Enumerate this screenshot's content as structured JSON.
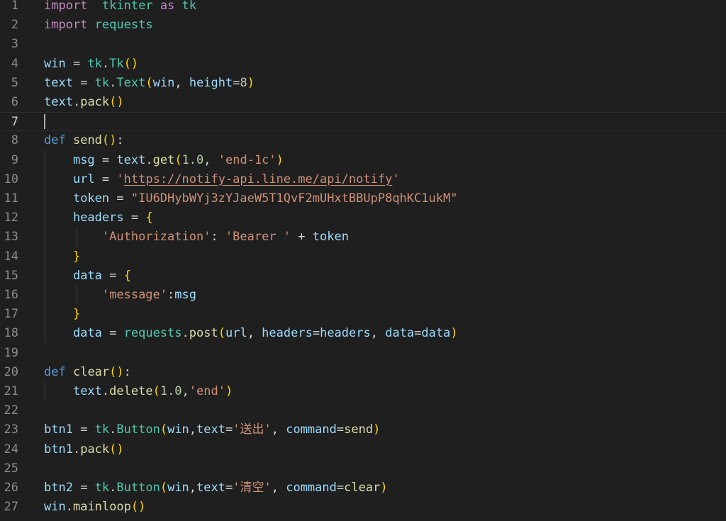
{
  "editor": {
    "active_line": 7,
    "lines": [
      {
        "n": "1",
        "tokens": [
          [
            "kw",
            "import"
          ],
          [
            "",
            "  "
          ],
          [
            "mod",
            "tkinter"
          ],
          [
            "",
            " "
          ],
          [
            "kw",
            "as"
          ],
          [
            "",
            " "
          ],
          [
            "mod",
            "tk"
          ]
        ]
      },
      {
        "n": "2",
        "tokens": [
          [
            "kw",
            "import"
          ],
          [
            "",
            " "
          ],
          [
            "mod",
            "requests"
          ]
        ]
      },
      {
        "n": "3",
        "tokens": []
      },
      {
        "n": "4",
        "tokens": [
          [
            "var",
            "win"
          ],
          [
            "op",
            " = "
          ],
          [
            "mod",
            "tk"
          ],
          [
            "op",
            "."
          ],
          [
            "mod",
            "Tk"
          ],
          [
            "p1",
            "()"
          ]
        ]
      },
      {
        "n": "5",
        "tokens": [
          [
            "var",
            "text"
          ],
          [
            "op",
            " = "
          ],
          [
            "mod",
            "tk"
          ],
          [
            "op",
            "."
          ],
          [
            "mod",
            "Text"
          ],
          [
            "p1",
            "("
          ],
          [
            "var",
            "win"
          ],
          [
            "op",
            ", "
          ],
          [
            "var",
            "height"
          ],
          [
            "op",
            "="
          ],
          [
            "num",
            "8"
          ],
          [
            "p1",
            ")"
          ]
        ]
      },
      {
        "n": "6",
        "tokens": [
          [
            "var",
            "text"
          ],
          [
            "op",
            "."
          ],
          [
            "fn",
            "pack"
          ],
          [
            "p1",
            "()"
          ]
        ]
      },
      {
        "n": "7",
        "tokens": []
      },
      {
        "n": "8",
        "tokens": [
          [
            "def",
            "def"
          ],
          [
            "",
            " "
          ],
          [
            "fn",
            "send"
          ],
          [
            "p1",
            "()"
          ],
          [
            "op",
            ":"
          ]
        ]
      },
      {
        "n": "9",
        "tokens": [
          [
            "",
            "    "
          ],
          [
            "var",
            "msg"
          ],
          [
            "op",
            " = "
          ],
          [
            "var",
            "text"
          ],
          [
            "op",
            "."
          ],
          [
            "fn",
            "get"
          ],
          [
            "p1",
            "("
          ],
          [
            "num",
            "1.0"
          ],
          [
            "op",
            ", "
          ],
          [
            "str",
            "'end-1c'"
          ],
          [
            "p1",
            ")"
          ]
        ]
      },
      {
        "n": "10",
        "tokens": [
          [
            "",
            "    "
          ],
          [
            "var",
            "url"
          ],
          [
            "op",
            " = "
          ],
          [
            "str",
            "'"
          ],
          [
            "url",
            "https://notify-api.line.me/api/notify"
          ],
          [
            "str",
            "'"
          ]
        ]
      },
      {
        "n": "11",
        "tokens": [
          [
            "",
            "    "
          ],
          [
            "var",
            "token"
          ],
          [
            "op",
            " = "
          ],
          [
            "str",
            "\"IU6DHybWYj3zYJaeW5T1QvF2mUHxtBBUpP8qhKC1ukM\""
          ]
        ]
      },
      {
        "n": "12",
        "tokens": [
          [
            "",
            "    "
          ],
          [
            "var",
            "headers"
          ],
          [
            "op",
            " = "
          ],
          [
            "p1",
            "{"
          ]
        ]
      },
      {
        "n": "13",
        "tokens": [
          [
            "",
            "        "
          ],
          [
            "str",
            "'Authorization'"
          ],
          [
            "op",
            ": "
          ],
          [
            "str",
            "'Bearer '"
          ],
          [
            "op",
            " + "
          ],
          [
            "var",
            "token"
          ]
        ]
      },
      {
        "n": "14",
        "tokens": [
          [
            "",
            "    "
          ],
          [
            "p1",
            "}"
          ]
        ]
      },
      {
        "n": "15",
        "tokens": [
          [
            "",
            "    "
          ],
          [
            "var",
            "data"
          ],
          [
            "op",
            " = "
          ],
          [
            "p1",
            "{"
          ]
        ]
      },
      {
        "n": "16",
        "tokens": [
          [
            "",
            "        "
          ],
          [
            "str",
            "'message'"
          ],
          [
            "op",
            ":"
          ],
          [
            "var",
            "msg"
          ]
        ]
      },
      {
        "n": "17",
        "tokens": [
          [
            "",
            "    "
          ],
          [
            "p1",
            "}"
          ]
        ]
      },
      {
        "n": "18",
        "tokens": [
          [
            "",
            "    "
          ],
          [
            "var",
            "data"
          ],
          [
            "op",
            " = "
          ],
          [
            "mod",
            "requests"
          ],
          [
            "op",
            "."
          ],
          [
            "fn",
            "post"
          ],
          [
            "p1",
            "("
          ],
          [
            "var",
            "url"
          ],
          [
            "op",
            ", "
          ],
          [
            "var",
            "headers"
          ],
          [
            "op",
            "="
          ],
          [
            "var",
            "headers"
          ],
          [
            "op",
            ", "
          ],
          [
            "var",
            "data"
          ],
          [
            "op",
            "="
          ],
          [
            "var",
            "data"
          ],
          [
            "p1",
            ")"
          ]
        ]
      },
      {
        "n": "19",
        "tokens": []
      },
      {
        "n": "20",
        "tokens": [
          [
            "def",
            "def"
          ],
          [
            "",
            " "
          ],
          [
            "fn",
            "clear"
          ],
          [
            "p1",
            "()"
          ],
          [
            "op",
            ":"
          ]
        ]
      },
      {
        "n": "21",
        "tokens": [
          [
            "",
            "    "
          ],
          [
            "var",
            "text"
          ],
          [
            "op",
            "."
          ],
          [
            "fn",
            "delete"
          ],
          [
            "p1",
            "("
          ],
          [
            "num",
            "1.0"
          ],
          [
            "op",
            ","
          ],
          [
            "str",
            "'end'"
          ],
          [
            "p1",
            ")"
          ]
        ]
      },
      {
        "n": "22",
        "tokens": []
      },
      {
        "n": "23",
        "tokens": [
          [
            "var",
            "btn1"
          ],
          [
            "op",
            " = "
          ],
          [
            "mod",
            "tk"
          ],
          [
            "op",
            "."
          ],
          [
            "mod",
            "Button"
          ],
          [
            "p1",
            "("
          ],
          [
            "var",
            "win"
          ],
          [
            "op",
            ","
          ],
          [
            "var",
            "text"
          ],
          [
            "op",
            "="
          ],
          [
            "str",
            "'送出'"
          ],
          [
            "op",
            ", "
          ],
          [
            "var",
            "command"
          ],
          [
            "op",
            "="
          ],
          [
            "fn",
            "send"
          ],
          [
            "p1",
            ")"
          ]
        ]
      },
      {
        "n": "24",
        "tokens": [
          [
            "var",
            "btn1"
          ],
          [
            "op",
            "."
          ],
          [
            "fn",
            "pack"
          ],
          [
            "p1",
            "()"
          ]
        ]
      },
      {
        "n": "25",
        "tokens": []
      },
      {
        "n": "26",
        "tokens": [
          [
            "var",
            "btn2"
          ],
          [
            "op",
            " = "
          ],
          [
            "mod",
            "tk"
          ],
          [
            "op",
            "."
          ],
          [
            "mod",
            "Button"
          ],
          [
            "p1",
            "("
          ],
          [
            "var",
            "win"
          ],
          [
            "op",
            ","
          ],
          [
            "var",
            "text"
          ],
          [
            "op",
            "="
          ],
          [
            "str",
            "'清空'"
          ],
          [
            "op",
            ", "
          ],
          [
            "var",
            "command"
          ],
          [
            "op",
            "="
          ],
          [
            "fn",
            "clear"
          ],
          [
            "p1",
            ")"
          ]
        ]
      },
      {
        "n": "27",
        "tokens": [
          [
            "var",
            "win"
          ],
          [
            "op",
            "."
          ],
          [
            "fn",
            "mainloop"
          ],
          [
            "p1",
            "()"
          ]
        ]
      }
    ]
  }
}
